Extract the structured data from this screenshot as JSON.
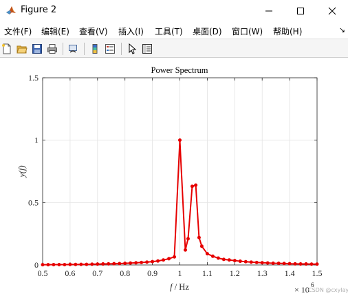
{
  "window": {
    "title": "Figure 2",
    "icon": "matlab-icon",
    "controls": [
      "minimize-icon",
      "maximize-icon",
      "close-icon"
    ]
  },
  "menu": {
    "items": [
      {
        "label": "文件(F)"
      },
      {
        "label": "编辑(E)"
      },
      {
        "label": "查看(V)"
      },
      {
        "label": "插入(I)"
      },
      {
        "label": "工具(T)"
      },
      {
        "label": "桌面(D)"
      },
      {
        "label": "窗口(W)"
      },
      {
        "label": "帮助(H)"
      }
    ],
    "overflow_icon": "dock-arrow-icon"
  },
  "toolbar": {
    "buttons": [
      "new-figure-icon",
      "open-file-icon",
      "save-icon",
      "print-icon",
      "link-plot-icon",
      "insert-colorbar-icon",
      "insert-legend-icon",
      "edit-plot-arrow-icon",
      "property-inspector-icon"
    ]
  },
  "watermark": "CSDN @cxylay",
  "chart_data": {
    "type": "line",
    "title": "Power Spectrum",
    "xlabel_italic": "f",
    "xlabel_unit": " / Hz",
    "ylabel": "y(f)",
    "x_multiplier": "× 10",
    "x_exponent": "6",
    "xlim": [
      500000,
      1500000
    ],
    "ylim": [
      0,
      1.5
    ],
    "xticks": [
      {
        "value": 500000,
        "label": "0.5"
      },
      {
        "value": 600000,
        "label": "0.6"
      },
      {
        "value": 700000,
        "label": "0.7"
      },
      {
        "value": 800000,
        "label": "0.8"
      },
      {
        "value": 900000,
        "label": "0.9"
      },
      {
        "value": 1000000,
        "label": "1"
      },
      {
        "value": 1100000,
        "label": "1.1"
      },
      {
        "value": 1200000,
        "label": "1.2"
      },
      {
        "value": 1300000,
        "label": "1.3"
      },
      {
        "value": 1400000,
        "label": "1.4"
      },
      {
        "value": 1500000,
        "label": "1.5"
      }
    ],
    "yticks": [
      {
        "value": 0,
        "label": "0"
      },
      {
        "value": 0.5,
        "label": "0.5"
      },
      {
        "value": 1,
        "label": "1"
      },
      {
        "value": 1.5,
        "label": "1.5"
      }
    ],
    "grid": true,
    "series": [
      {
        "color": "#e60000",
        "marker": "dot",
        "x": [
          500000,
          520000,
          540000,
          560000,
          580000,
          600000,
          620000,
          640000,
          660000,
          680000,
          700000,
          720000,
          740000,
          760000,
          780000,
          800000,
          820000,
          840000,
          860000,
          880000,
          900000,
          920000,
          940000,
          960000,
          980000,
          1000000,
          1020000,
          1030000,
          1045000,
          1058000,
          1070000,
          1080000,
          1100000,
          1120000,
          1140000,
          1160000,
          1180000,
          1200000,
          1220000,
          1240000,
          1260000,
          1280000,
          1300000,
          1320000,
          1340000,
          1360000,
          1380000,
          1400000,
          1420000,
          1440000,
          1460000,
          1480000,
          1500000
        ],
        "y": [
          0.002,
          0.002,
          0.003,
          0.003,
          0.003,
          0.004,
          0.004,
          0.005,
          0.005,
          0.006,
          0.007,
          0.008,
          0.009,
          0.01,
          0.011,
          0.013,
          0.015,
          0.017,
          0.02,
          0.023,
          0.027,
          0.032,
          0.04,
          0.05,
          0.065,
          1.0,
          0.12,
          0.21,
          0.63,
          0.64,
          0.22,
          0.15,
          0.09,
          0.07,
          0.055,
          0.045,
          0.04,
          0.035,
          0.03,
          0.026,
          0.023,
          0.02,
          0.018,
          0.016,
          0.014,
          0.013,
          0.012,
          0.01,
          0.009,
          0.008,
          0.008,
          0.007,
          0.007
        ]
      }
    ]
  }
}
